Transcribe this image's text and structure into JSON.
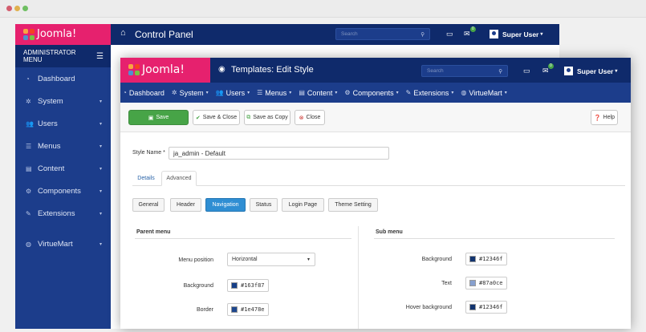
{
  "background_app": {
    "logo_text": "Joomla!",
    "title": "Control Panel",
    "search_placeholder": "Search",
    "user": "Super User",
    "notify_count": "0",
    "menu_header": "ADMINISTRATOR MENU",
    "menu": [
      {
        "label": "Dashboard",
        "icon": "dashboard-icon",
        "glyph": "◔"
      },
      {
        "label": "System",
        "icon": "cog-icon",
        "glyph": "✲"
      },
      {
        "label": "Users",
        "icon": "users-icon",
        "glyph": "👥"
      },
      {
        "label": "Menus",
        "icon": "list-icon",
        "glyph": "☰"
      },
      {
        "label": "Content",
        "icon": "file-icon",
        "glyph": "▤"
      },
      {
        "label": "Components",
        "icon": "cogs-icon",
        "glyph": "⚙"
      },
      {
        "label": "Extensions",
        "icon": "plug-icon",
        "glyph": "✎"
      },
      {
        "label": "VirtueMart",
        "icon": "globe-icon",
        "glyph": "◍"
      }
    ]
  },
  "foreground_app": {
    "logo_text": "Joomla!",
    "title": "Templates: Edit Style",
    "search_placeholder": "Search",
    "user": "Super User",
    "notify_count": "0",
    "nav": [
      {
        "label": "Dashboard",
        "glyph": "◔",
        "caret": false
      },
      {
        "label": "System",
        "glyph": "✲",
        "caret": true
      },
      {
        "label": "Users",
        "glyph": "👥",
        "caret": true
      },
      {
        "label": "Menus",
        "glyph": "☰",
        "caret": true
      },
      {
        "label": "Content",
        "glyph": "▤",
        "caret": true
      },
      {
        "label": "Components",
        "glyph": "⚙",
        "caret": true
      },
      {
        "label": "Extensions",
        "glyph": "✎",
        "caret": true
      },
      {
        "label": "VirtueMart",
        "glyph": "◍",
        "caret": true
      }
    ],
    "toolbar": {
      "save": "Save",
      "save_close": "Save & Close",
      "save_copy": "Save as Copy",
      "close": "Close",
      "help": "Help"
    },
    "style_name_label": "Style Name *",
    "style_name_value": "ja_admin - Default",
    "tabs": [
      "Details",
      "Advanced"
    ],
    "pills": [
      "General",
      "Header",
      "Navigation",
      "Status",
      "Login Page",
      "Theme Setting"
    ],
    "parent_menu": {
      "heading": "Parent menu",
      "position_label": "Menu position",
      "position_value": "Horizontal",
      "background_label": "Background",
      "background_value": "#163f87",
      "border_label": "Border",
      "border_value": "#1e478e"
    },
    "sub_menu": {
      "heading": "Sub menu",
      "background_label": "Background",
      "background_value": "#12346f",
      "text_label": "Text",
      "text_value": "#87a0ce",
      "hover_label": "Hover background",
      "hover_value": "#12346f"
    }
  },
  "colors": {
    "navy": "#0f2a6b",
    "blue": "#1c3d8b",
    "pink": "#e6216e",
    "green": "#47a447",
    "active_pill": "#2f8ed3"
  }
}
